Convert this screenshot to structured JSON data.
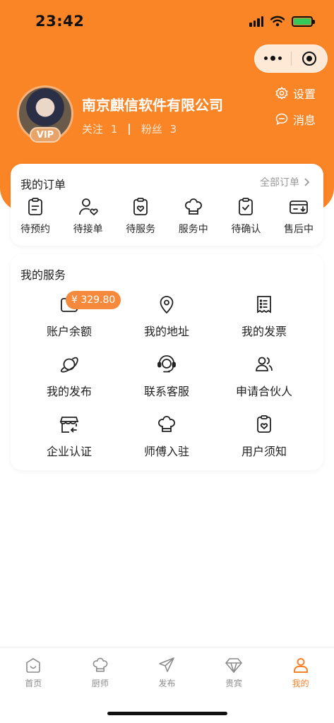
{
  "status_bar": {
    "time": "23:42",
    "icons": [
      "signal-icon",
      "wifi-icon",
      "battery-charging-icon"
    ]
  },
  "colors": {
    "accent": "#fa8526",
    "badge": "#f58a3c",
    "active_tab": "#f6812a"
  },
  "profile": {
    "avatar_icon": "avatar",
    "vip_label": "VIP",
    "company_name": "南京麒信软件有限公司",
    "follow_label": "关注",
    "follow_count": "1",
    "fans_label": "粉丝",
    "fans_count": "3",
    "settings_label": "设置",
    "messages_label": "消息"
  },
  "orders": {
    "title": "我的订单",
    "all_label": "全部订单",
    "items": [
      {
        "label": "待预约",
        "icon": "clipboard-list-icon"
      },
      {
        "label": "待接单",
        "icon": "user-heart-icon"
      },
      {
        "label": "待服务",
        "icon": "clipboard-heart-icon"
      },
      {
        "label": "服务中",
        "icon": "chef-hat-icon"
      },
      {
        "label": "待确认",
        "icon": "clipboard-check-icon"
      },
      {
        "label": "售后中",
        "icon": "card-return-icon"
      }
    ]
  },
  "services": {
    "title": "我的服务",
    "balance_badge": "¥ 329.80",
    "items": [
      {
        "label": "账户余额",
        "icon": "wallet-icon"
      },
      {
        "label": "我的地址",
        "icon": "location-pin-icon"
      },
      {
        "label": "我的发票",
        "icon": "receipt-icon"
      },
      {
        "label": "我的发布",
        "icon": "planet-icon"
      },
      {
        "label": "联系客服",
        "icon": "headset-icon"
      },
      {
        "label": "申请合伙人",
        "icon": "users-icon"
      },
      {
        "label": "企业认证",
        "icon": "storefront-icon"
      },
      {
        "label": "师傅入驻",
        "icon": "chef-hat-icon"
      },
      {
        "label": "用户须知",
        "icon": "clipboard-heart-icon"
      }
    ]
  },
  "tabbar": {
    "active": "我的",
    "items": [
      {
        "label": "首页",
        "icon": "home-icon"
      },
      {
        "label": "厨师",
        "icon": "chef-hat-icon"
      },
      {
        "label": "发布",
        "icon": "send-icon"
      },
      {
        "label": "贵宾",
        "icon": "diamond-icon"
      },
      {
        "label": "我的",
        "icon": "user-icon"
      }
    ]
  }
}
